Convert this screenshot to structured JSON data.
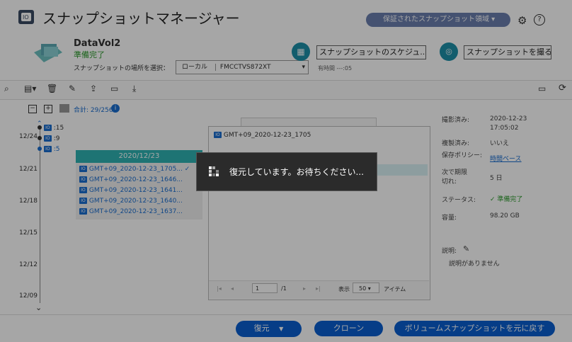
{
  "app": {
    "title": "スナップショットマネージャー",
    "protected_area": "保証されたスナップショット領域"
  },
  "volume": {
    "name": "DataVol2",
    "status": "準備完了",
    "location_label": "スナップショットの場所を選択：",
    "location_value": "ローカル",
    "device": "FMCCTVS872XT",
    "time_label": "有時間 ---:05"
  },
  "actions": {
    "schedule": "スナップショットのスケジュ...",
    "take": "スナップショットを撮る"
  },
  "filter": {
    "total": "合計: 29/256"
  },
  "timeline": {
    "dates": [
      "12/24",
      "12/21",
      "12/18",
      "12/15",
      "12/12",
      "12/09"
    ],
    "points": [
      ":15",
      ":9",
      ":5"
    ],
    "group_header": "2020/12/23",
    "items": [
      "GMT+09_2020-12-23_1705...",
      "GMT+09_2020-12-23_1646...",
      "GMT+09_2020-12-23_1641...",
      "GMT+09_2020-12-23_1640...",
      "GMT+09_2020-12-23_1637..."
    ]
  },
  "details": {
    "taken_label": "撮影済み:",
    "taken_value": "2020-12-23\n17:05:02",
    "replicated_label": "複製済み:",
    "replicated_value": "いいえ",
    "policy_label": "保存ポリシー:",
    "policy_value": "時間ベース",
    "expire_label": "次で期限切れ:",
    "expire_value": "5 日",
    "status_label": "ステータス:",
    "status_value": "準備完了",
    "size_label": "容量:",
    "size_value": "98.20 GB",
    "desc_label": "説明:",
    "desc_value": "説明がありません"
  },
  "preview": {
    "title": "GMT+09_2020-12-23_1705",
    "page": "1",
    "page_of": "/1",
    "show_label": "表示",
    "per_page": "50",
    "items_label": "アイテム"
  },
  "buttons": {
    "restore": "復元",
    "clone": "クローン",
    "revert": "ボリュームスナップショットを元に戻す"
  },
  "loading": {
    "text": "復元しています。お待ちください..."
  }
}
